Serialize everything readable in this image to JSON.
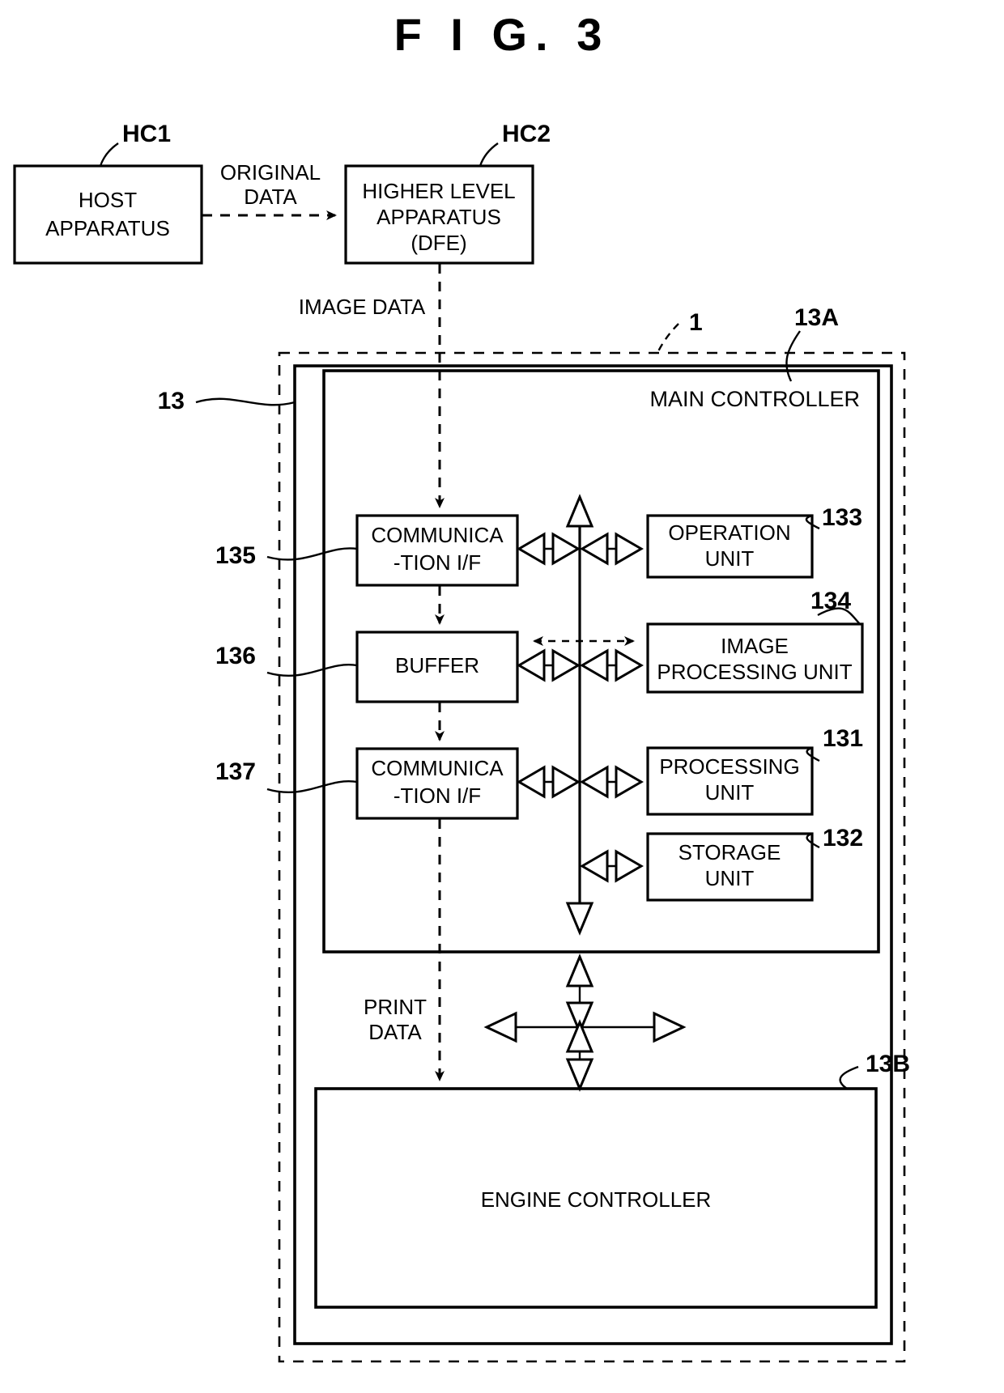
{
  "figure": {
    "title": "F I G.   3",
    "title_plain": "FIG. 3"
  },
  "blocks": {
    "host_apparatus": {
      "line1": "HOST",
      "line2": "APPARATUS",
      "ref": "HC1"
    },
    "higher_level_apparatus": {
      "line1": "HIGHER LEVEL",
      "line2": "APPARATUS",
      "line3": "(DFE)",
      "ref": "HC2"
    },
    "communication_if_top": {
      "line1": "COMMUNICA",
      "line2": "-TION I/F",
      "ref": "135"
    },
    "buffer": {
      "line1": "BUFFER",
      "ref": "136"
    },
    "communication_if_bottom": {
      "line1": "COMMUNICA",
      "line2": "-TION I/F",
      "ref": "137"
    },
    "operation_unit": {
      "line1": "OPERATION",
      "line2": "UNIT",
      "ref": "133"
    },
    "image_processing_unit": {
      "line1": "IMAGE",
      "line2": "PROCESSING UNIT",
      "ref": "134"
    },
    "processing_unit": {
      "line1": "PROCESSING",
      "line2": "UNIT",
      "ref": "131"
    },
    "storage_unit": {
      "line1": "STORAGE",
      "line2": "UNIT",
      "ref": "132"
    },
    "engine_controller": {
      "line1": "ENGINE CONTROLLER",
      "ref": "13B"
    },
    "main_controller": {
      "label": "MAIN CONTROLLER",
      "ref": "13A"
    }
  },
  "containers": {
    "printing_apparatus": {
      "ref": "1"
    },
    "controller": {
      "ref": "13"
    }
  },
  "flows": {
    "original_data": {
      "line1": "ORIGINAL",
      "line2": "DATA"
    },
    "image_data": {
      "label": "IMAGE DATA"
    },
    "print_data": {
      "line1": "PRINT",
      "line2": "DATA"
    }
  },
  "colors": {
    "ink": "#000000",
    "paper": "#ffffff"
  }
}
